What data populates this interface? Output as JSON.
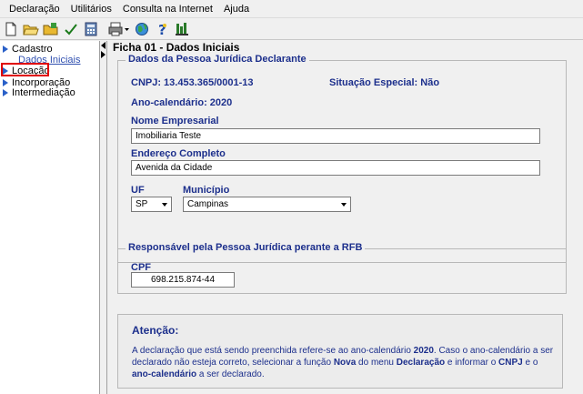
{
  "menu": [
    "Declaração",
    "Utilitários",
    "Consulta na Internet",
    "Ajuda"
  ],
  "toolbar_icons": [
    "new-icon",
    "open-icon",
    "folder-icon",
    "check-icon",
    "calculator-icon",
    "print-icon",
    "globe-icon",
    "help-icon",
    "tools-icon"
  ],
  "tree": {
    "cadastro": "Cadastro",
    "dados_iniciais": "Dados Iniciais",
    "locacao": "Locação",
    "incorporacao": "Incorporação",
    "intermediacao": "Intermediação"
  },
  "form": {
    "title": "Ficha 01 - Dados Iniciais",
    "group1_legend": "Dados da Pessoa Jurídica Declarante",
    "cnpj_line": "CNPJ: 13.453.365/0001-13",
    "situacao_line": "Situação Especial: Não",
    "ano_line": "Ano-calendário: 2020",
    "nome_label": "Nome Empresarial",
    "nome_value": "Imobiliaria Teste",
    "endereco_label": "Endereço Completo",
    "endereco_value": "Avenida da Cidade",
    "uf_label": "UF",
    "uf_value": "SP",
    "municipio_label": "Município",
    "municipio_value": "Campinas",
    "group2_legend": "Responsável pela Pessoa Jurídica perante a RFB",
    "cpf_label": "CPF",
    "cpf_value": "698.215.874-44"
  },
  "note": {
    "title": "Atenção:",
    "t1": "A declaração que está sendo preenchida refere-se ao ano-calendário ",
    "b1": "2020",
    "t2": ". Caso o ano-calendário a ser declarado não esteja correto, selecionar a função ",
    "b2": "Nova",
    "t3": " do menu ",
    "b3": "Declaração",
    "t4": " e informar o ",
    "b4": "CNPJ",
    "t5": " e o ",
    "b5": "ano-calendário",
    "t6": " a ser declarado."
  },
  "colors": {
    "label_blue": "#1c2f8c",
    "tree_arrow": "#2a60c8",
    "highlight": "#e00000"
  }
}
